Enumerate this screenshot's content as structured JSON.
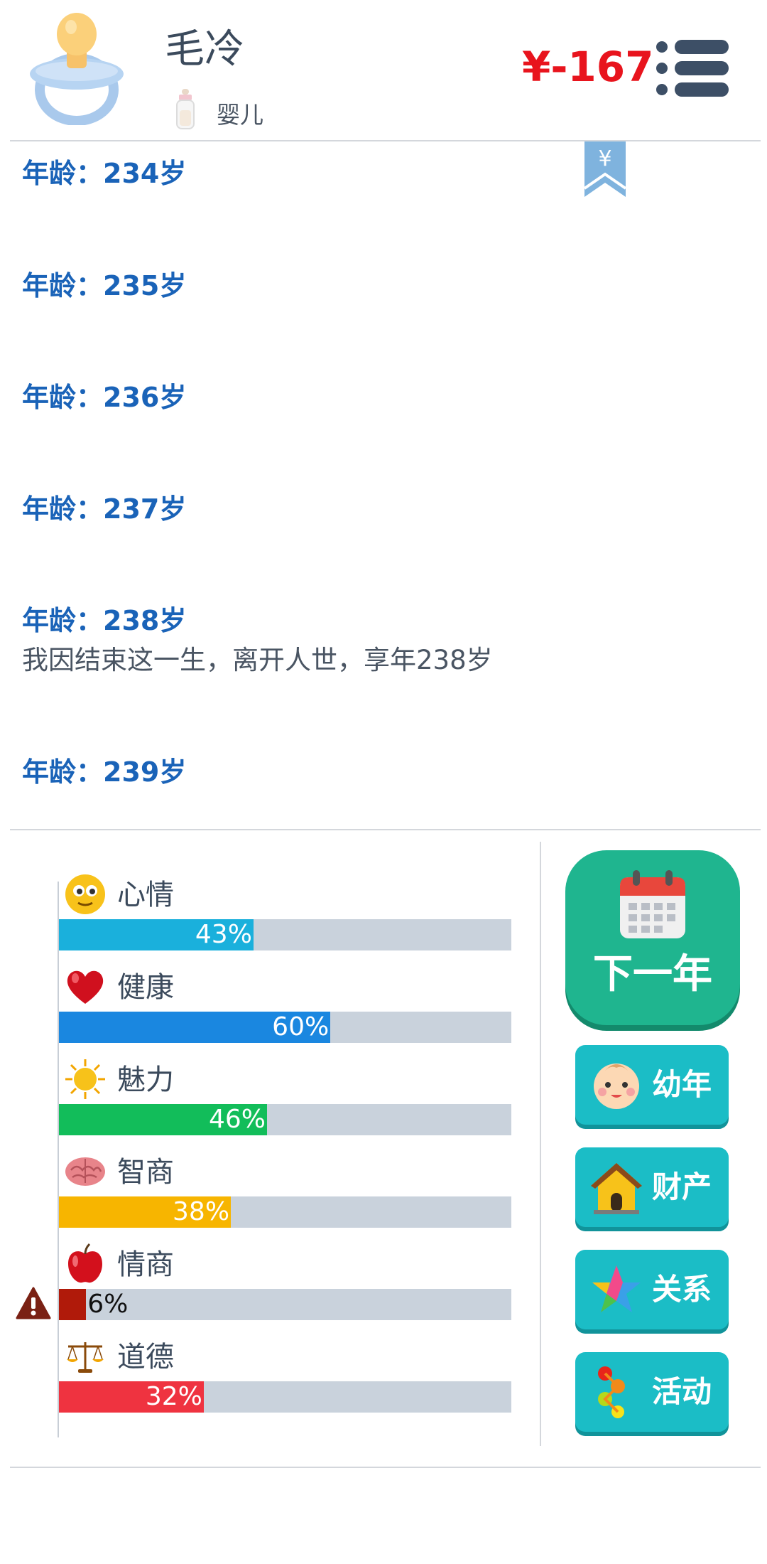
{
  "header": {
    "player_name": "毛冷",
    "life_stage": "婴儿",
    "money": "¥-167"
  },
  "log": {
    "entries": [
      {
        "age_label": "年龄：234岁",
        "events": []
      },
      {
        "age_label": "年龄：235岁",
        "events": []
      },
      {
        "age_label": "年龄：236岁",
        "events": []
      },
      {
        "age_label": "年龄：237岁",
        "events": []
      },
      {
        "age_label": "年龄：238岁",
        "events": [
          "我因结束这一生，离开人世，享年238岁"
        ]
      },
      {
        "age_label": "年龄：239岁",
        "events": []
      }
    ],
    "bookmark_symbol": "¥"
  },
  "stats": [
    {
      "name": "心情",
      "percent": 43,
      "percent_label": "43%",
      "color": "#1ab0dc",
      "icon": "smiley-icon"
    },
    {
      "name": "健康",
      "percent": 60,
      "percent_label": "60%",
      "color": "#1a87e0",
      "icon": "heart-icon"
    },
    {
      "name": "魅力",
      "percent": 46,
      "percent_label": "46%",
      "color": "#12bd5a",
      "icon": "sun-icon"
    },
    {
      "name": "智商",
      "percent": 38,
      "percent_label": "38%",
      "color": "#f7b500",
      "icon": "brain-icon"
    },
    {
      "name": "情商",
      "percent": 6,
      "percent_label": "6%",
      "color": "#b01a0a",
      "icon": "apple-icon",
      "warning": true
    },
    {
      "name": "道德",
      "percent": 32,
      "percent_label": "32%",
      "color": "#ef3340",
      "icon": "scales-icon"
    }
  ],
  "actions": {
    "next_year": "下一年",
    "buttons": [
      {
        "label": "幼年",
        "icon": "baby-face-icon"
      },
      {
        "label": "财产",
        "icon": "house-icon"
      },
      {
        "label": "关系",
        "icon": "star-icon"
      },
      {
        "label": "活动",
        "icon": "dots-icon"
      }
    ]
  },
  "colors": {
    "money": "#e8141d",
    "age_label": "#1a63b8",
    "next_year_button": "#1fb58f",
    "side_button": "#1bbdc6",
    "bar_track": "#c9d2dc"
  }
}
